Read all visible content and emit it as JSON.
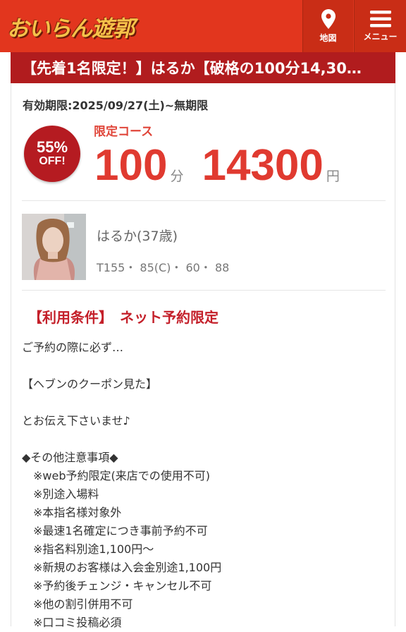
{
  "header": {
    "logo_text": "おいらん遊郭",
    "map_label": "地図",
    "menu_label": "メニュー",
    "brand_color": "#e2361e"
  },
  "title": "【先着1名限定！】はるか【破格の100分14,30…",
  "coupon": {
    "validity": "有効期限:2025/09/27(土)~無期限",
    "badge_pct": "55%",
    "badge_off": "OFF!",
    "course_label": "限定コース",
    "minutes": "100",
    "minutes_unit": "分",
    "price": "14300",
    "price_unit": "円"
  },
  "profile": {
    "name": "はるか(37歳)",
    "spec": "T155・ 85(C)・ 60・ 88"
  },
  "conditions": {
    "title": "【利用条件】　ネット予約限定",
    "lines": [
      {
        "text": "ご予約の際に必ず…",
        "indent": false
      },
      {
        "text": "",
        "indent": false
      },
      {
        "text": "【ヘブンのクーポン見た】",
        "indent": false
      },
      {
        "text": "",
        "indent": false
      },
      {
        "text": "とお伝え下さいませ♪",
        "indent": false
      },
      {
        "text": "",
        "indent": false
      },
      {
        "text": "◆その他注意事項◆",
        "indent": false
      },
      {
        "text": "※web予約限定(来店での使用不可)",
        "indent": true
      },
      {
        "text": "※別途入場料",
        "indent": true
      },
      {
        "text": "※本指名様対象外",
        "indent": true
      },
      {
        "text": "※最速1名確定につき事前予約不可",
        "indent": true
      },
      {
        "text": "※指名料別途1,100円～",
        "indent": true
      },
      {
        "text": "※新規のお客様は入会金別途1,100円",
        "indent": true
      },
      {
        "text": "※予約後チェンジ・キャンセル不可",
        "indent": true
      },
      {
        "text": "※他の割引併用不可",
        "indent": true
      },
      {
        "text": "※口コミ投稿必須",
        "indent": true
      }
    ]
  }
}
